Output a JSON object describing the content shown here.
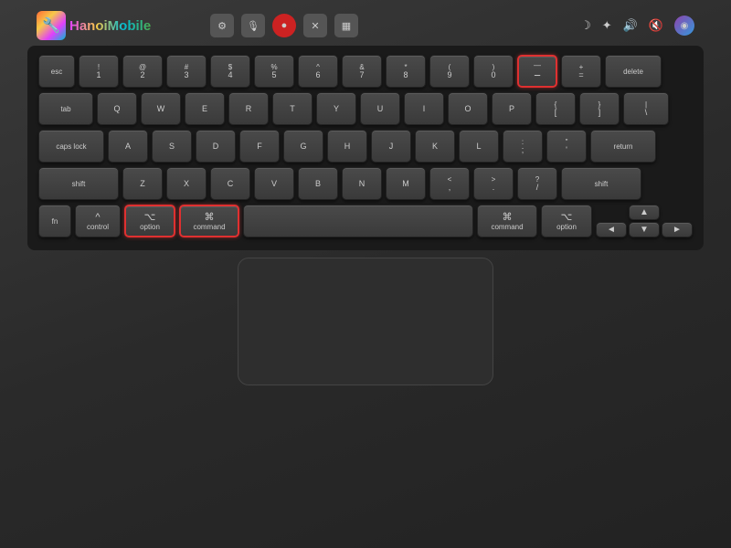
{
  "logo": {
    "text": "HanoiMobile",
    "icon": "🔧"
  },
  "topbar_icons": [
    "⚙",
    "🎙",
    "●",
    "X",
    "▦",
    "☽",
    "☀",
    "🔊",
    "🔇",
    "◉"
  ],
  "keyboard": {
    "highlighted_keys": [
      "minus_key",
      "option_key",
      "command_l_key"
    ],
    "rows": {
      "row0_labels": [
        "esc",
        "!",
        "@",
        "#",
        "$",
        "%",
        "^",
        "&",
        "*",
        "(",
        ")",
        "-",
        "+",
        "delete"
      ],
      "row0_sub": [
        "",
        "1",
        "2",
        "3",
        "4",
        "5",
        "6",
        "7",
        "8",
        "9",
        "0",
        "-",
        "=",
        ""
      ],
      "row1": [
        "tab",
        "Q",
        "W",
        "E",
        "R",
        "T",
        "Y",
        "U",
        "I",
        "O",
        "P",
        "{",
        "}",
        "\\"
      ],
      "row2": [
        "caps lock",
        "A",
        "S",
        "D",
        "F",
        "G",
        "H",
        "J",
        "K",
        "L",
        ";",
        "\"",
        "return"
      ],
      "row3": [
        "shift",
        "Z",
        "X",
        "C",
        "V",
        "B",
        "N",
        "M",
        "<",
        ">",
        "?",
        "shift"
      ],
      "row4_labels": [
        "fn",
        "control",
        "⌥\noption",
        "⌘\ncommand",
        "",
        "⌘\ncommand",
        "⌥\noption",
        "◄",
        "▲▼",
        "►"
      ]
    }
  }
}
